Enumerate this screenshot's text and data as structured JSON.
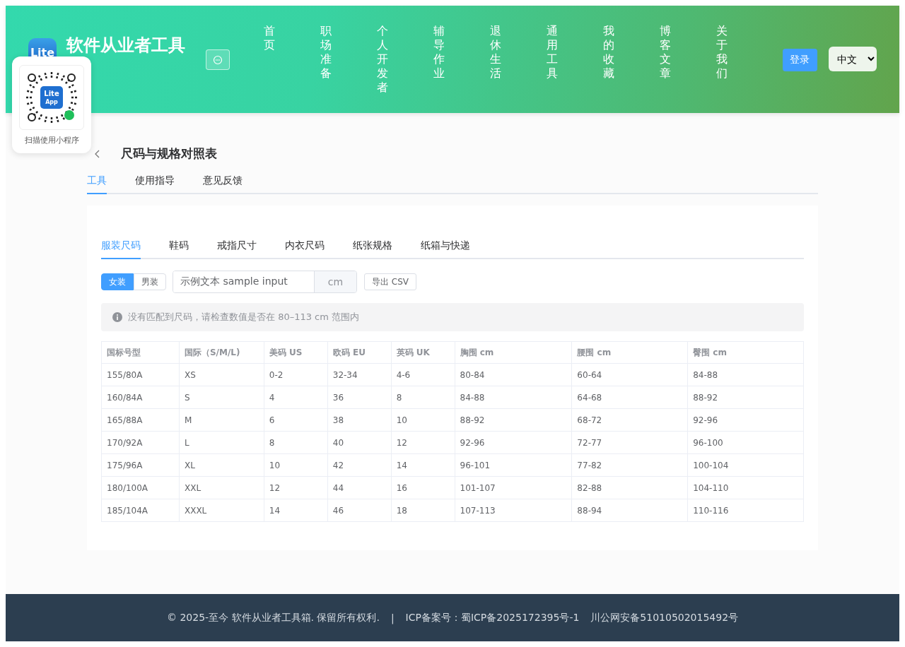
{
  "header": {
    "logo_text": "Lite",
    "site_title": "软件从业者工具",
    "nav": [
      {
        "label": "首页",
        "selected": false
      },
      {
        "label": "职场准备",
        "selected": false
      },
      {
        "label": "个人开发者",
        "selected": false
      },
      {
        "label": "辅导作业",
        "selected": false
      },
      {
        "label": "退休生活",
        "selected": false
      },
      {
        "label": "通用工具",
        "selected": false
      },
      {
        "label": "我的收藏",
        "selected": false
      },
      {
        "label": "博客文章",
        "selected": false
      },
      {
        "label": "关于我们",
        "selected": false
      }
    ],
    "login_button": "登录",
    "language": "中文"
  },
  "qr_popup": {
    "badge_top": "Lite",
    "badge_bottom": "App",
    "caption": "扫描使用小程序"
  },
  "page": {
    "title": "尺码与规格对照表",
    "tabs": [
      {
        "label": "工具",
        "selected": true
      },
      {
        "label": "使用指导",
        "selected": false
      },
      {
        "label": "意见反馈",
        "selected": false
      }
    ]
  },
  "tool": {
    "tabs": [
      {
        "label": "服装尺码",
        "selected": true
      },
      {
        "label": "鞋码",
        "selected": false
      },
      {
        "label": "戒指尺寸",
        "selected": false
      },
      {
        "label": "内衣尺码",
        "selected": false
      },
      {
        "label": "纸张规格",
        "selected": false
      },
      {
        "label": "纸箱与快递",
        "selected": false
      }
    ],
    "gender": [
      {
        "label": "女装",
        "selected": true
      },
      {
        "label": "男装",
        "selected": false
      }
    ],
    "input": {
      "value": "示例文本 sample input",
      "unit": "cm"
    },
    "export_button": "导出 CSV",
    "alert": "没有匹配到尺码，请检查数值是否在 80–113 cm 范围内",
    "table": {
      "columns": [
        "国标号型",
        "国际（S/M/L)",
        "美码 US",
        "欧码 EU",
        "英码 UK",
        "胸围 cm",
        "腰围 cm",
        "臀围 cm"
      ],
      "rows": [
        [
          "155/80A",
          "XS",
          "0-2",
          "32-34",
          "4-6",
          "80-84",
          "60-64",
          "84-88"
        ],
        [
          "160/84A",
          "S",
          "4",
          "36",
          "8",
          "84-88",
          "64-68",
          "88-92"
        ],
        [
          "165/88A",
          "M",
          "6",
          "38",
          "10",
          "88-92",
          "68-72",
          "92-96"
        ],
        [
          "170/92A",
          "L",
          "8",
          "40",
          "12",
          "92-96",
          "72-77",
          "96-100"
        ],
        [
          "175/96A",
          "XL",
          "10",
          "42",
          "14",
          "96-101",
          "77-82",
          "100-104"
        ],
        [
          "180/100A",
          "XXL",
          "12",
          "44",
          "16",
          "101-107",
          "82-88",
          "104-110"
        ],
        [
          "185/104A",
          "XXXL",
          "14",
          "46",
          "18",
          "107-113",
          "88-94",
          "110-116"
        ]
      ]
    }
  },
  "footer": {
    "copyright": "© 2025-至今 软件从业者工具箱. 保留所有权利.",
    "separator": "|",
    "icp": "ICP备案号：蜀ICP备2025172395号-1",
    "police": "川公网安备51010502015492号"
  }
}
